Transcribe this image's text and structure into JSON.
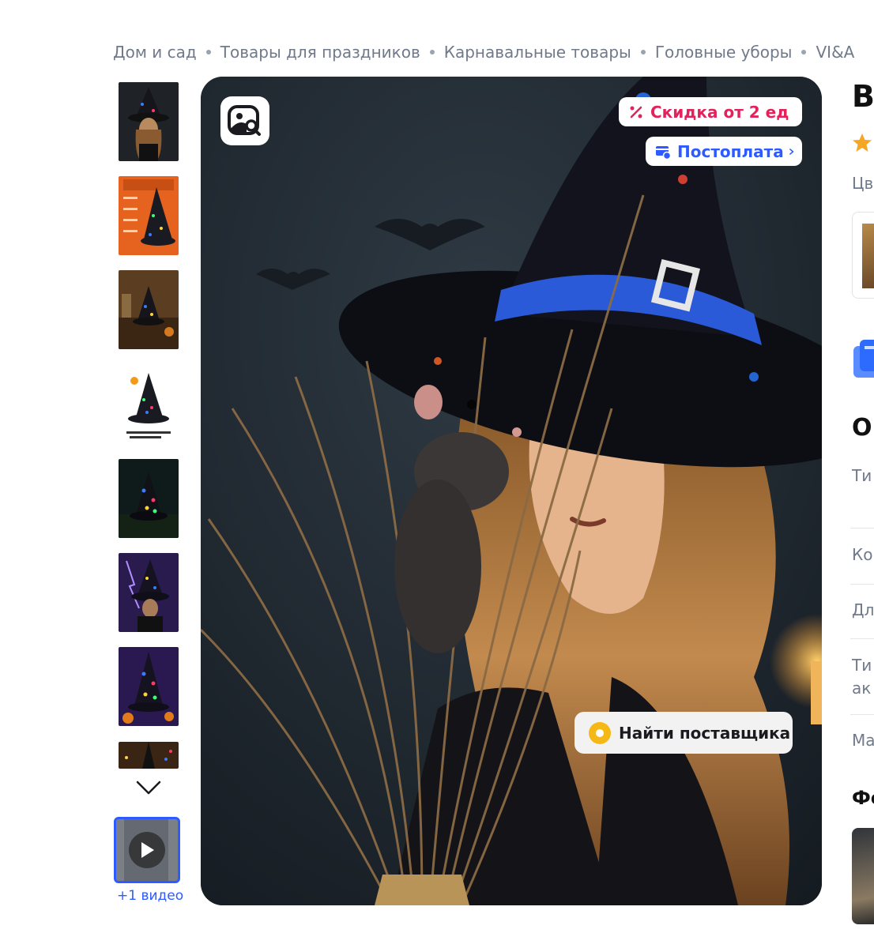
{
  "breadcrumb": [
    {
      "label": "Дом и сад"
    },
    {
      "label": "Товары для праздников"
    },
    {
      "label": "Карнавальные товары"
    },
    {
      "label": "Головные уборы"
    },
    {
      "label": "VI&A"
    }
  ],
  "gallery": {
    "thumbnails": [
      {
        "alt": "witch-woman-photo"
      },
      {
        "alt": "infographic-orange"
      },
      {
        "alt": "hat-in-room"
      },
      {
        "alt": "hat-dimensions"
      },
      {
        "alt": "hat-dark-forest"
      },
      {
        "alt": "witch-purple-lightning"
      },
      {
        "alt": "hat-purple-pumpkins"
      },
      {
        "alt": "hat-lights-partial"
      }
    ],
    "video_label": "+1 видео"
  },
  "main_image": {
    "badges": {
      "discount": "Скидка от 2 ед",
      "postpay": "Постоплата"
    },
    "find_supplier": "Найти поставщика"
  },
  "right_panel": {
    "title_fragment": "В",
    "color_label": "Цв",
    "section_title": "О",
    "spec_labels": [
      "Ти",
      "Ко",
      "Дл",
      "Ти",
      "ак",
      "Ма"
    ],
    "photos_title": "Фо"
  },
  "colors": {
    "accent_blue": "#2d5bff",
    "discount_red": "#e3215b",
    "supplier_yellow": "#f6b816",
    "rating_orange": "#f5a623"
  }
}
